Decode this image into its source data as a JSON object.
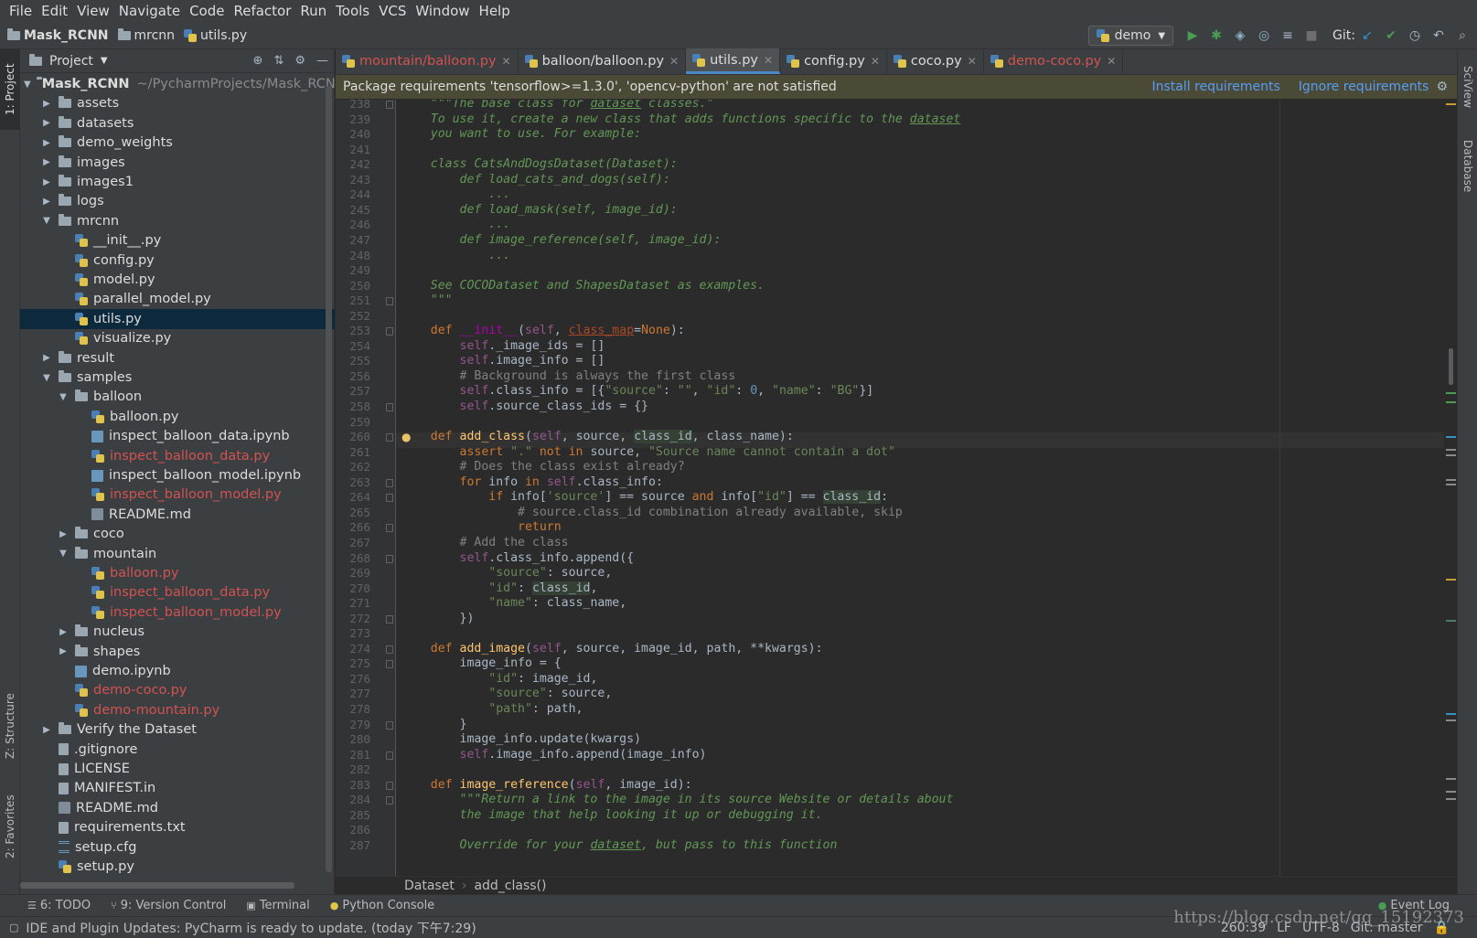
{
  "menu": [
    "File",
    "Edit",
    "View",
    "Navigate",
    "Code",
    "Refactor",
    "Run",
    "Tools",
    "VCS",
    "Window",
    "Help"
  ],
  "breadcrumb": {
    "project": "Mask_RCNN",
    "folder": "mrcnn",
    "file": "utils.py"
  },
  "run_config": "demo",
  "git_label": "Git:",
  "project_panel": {
    "title": "Project"
  },
  "tree": [
    {
      "indent": 0,
      "arrow": "down",
      "icon": "folder",
      "label": "Mask_RCNN",
      "path": "~/PycharmProjects/Mask_RCNN",
      "bold": true
    },
    {
      "indent": 1,
      "arrow": "right",
      "icon": "folder",
      "label": "assets"
    },
    {
      "indent": 1,
      "arrow": "right",
      "icon": "folder",
      "label": "datasets"
    },
    {
      "indent": 1,
      "arrow": "right",
      "icon": "folder",
      "label": "demo_weights"
    },
    {
      "indent": 1,
      "arrow": "right",
      "icon": "folder",
      "label": "images"
    },
    {
      "indent": 1,
      "arrow": "right",
      "icon": "folder",
      "label": "images1"
    },
    {
      "indent": 1,
      "arrow": "right",
      "icon": "folder",
      "label": "logs"
    },
    {
      "indent": 1,
      "arrow": "down",
      "icon": "folder",
      "label": "mrcnn"
    },
    {
      "indent": 2,
      "icon": "py",
      "label": "__init__.py"
    },
    {
      "indent": 2,
      "icon": "py",
      "label": "config.py"
    },
    {
      "indent": 2,
      "icon": "py",
      "label": "model.py"
    },
    {
      "indent": 2,
      "icon": "py",
      "label": "parallel_model.py"
    },
    {
      "indent": 2,
      "icon": "py",
      "label": "utils.py",
      "selected": true
    },
    {
      "indent": 2,
      "icon": "py",
      "label": "visualize.py"
    },
    {
      "indent": 1,
      "arrow": "right",
      "icon": "folder",
      "label": "result"
    },
    {
      "indent": 1,
      "arrow": "down",
      "icon": "folder",
      "label": "samples"
    },
    {
      "indent": 2,
      "arrow": "down",
      "icon": "folder",
      "label": "balloon"
    },
    {
      "indent": 3,
      "icon": "py",
      "label": "balloon.py"
    },
    {
      "indent": 3,
      "icon": "nb",
      "label": "inspect_balloon_data.ipynb"
    },
    {
      "indent": 3,
      "icon": "py",
      "label": "inspect_balloon_data.py",
      "red": true
    },
    {
      "indent": 3,
      "icon": "nb",
      "label": "inspect_balloon_model.ipynb"
    },
    {
      "indent": 3,
      "icon": "py",
      "label": "inspect_balloon_model.py",
      "red": true
    },
    {
      "indent": 3,
      "icon": "md",
      "label": "README.md"
    },
    {
      "indent": 2,
      "arrow": "right",
      "icon": "folder",
      "label": "coco"
    },
    {
      "indent": 2,
      "arrow": "down",
      "icon": "folder",
      "label": "mountain"
    },
    {
      "indent": 3,
      "icon": "py",
      "label": "balloon.py",
      "red": true
    },
    {
      "indent": 3,
      "icon": "py",
      "label": "inspect_balloon_data.py",
      "red": true
    },
    {
      "indent": 3,
      "icon": "py",
      "label": "inspect_balloon_model.py",
      "red": true
    },
    {
      "indent": 2,
      "arrow": "right",
      "icon": "folder",
      "label": "nucleus"
    },
    {
      "indent": 2,
      "arrow": "right",
      "icon": "folder",
      "label": "shapes"
    },
    {
      "indent": 2,
      "icon": "nb",
      "label": "demo.ipynb"
    },
    {
      "indent": 2,
      "icon": "py",
      "label": "demo-coco.py",
      "red": true
    },
    {
      "indent": 2,
      "icon": "py",
      "label": "demo-mountain.py",
      "red": true
    },
    {
      "indent": 1,
      "arrow": "right",
      "icon": "folder",
      "label": "Verify the Dataset"
    },
    {
      "indent": 1,
      "icon": "file",
      "label": ".gitignore"
    },
    {
      "indent": 1,
      "icon": "file",
      "label": "LICENSE"
    },
    {
      "indent": 1,
      "icon": "file",
      "label": "MANIFEST.in"
    },
    {
      "indent": 1,
      "icon": "md",
      "label": "README.md"
    },
    {
      "indent": 1,
      "icon": "file",
      "label": "requirements.txt"
    },
    {
      "indent": 1,
      "icon": "txt",
      "label": "setup.cfg"
    },
    {
      "indent": 1,
      "icon": "py",
      "label": "setup.py"
    }
  ],
  "tabs": [
    {
      "label": "mountain/balloon.py",
      "red": true
    },
    {
      "label": "balloon/balloon.py"
    },
    {
      "label": "utils.py",
      "active": true
    },
    {
      "label": "config.py"
    },
    {
      "label": "coco.py"
    },
    {
      "label": "demo-coco.py",
      "red": true
    }
  ],
  "banner": {
    "message": "Package requirements 'tensorflow>=1.3.0', 'opencv-python' are not satisfied",
    "install": "Install requirements",
    "ignore": "Ignore requirements"
  },
  "code": {
    "first_line": 238,
    "current_line": 260,
    "lines": [
      [
        [
          "d",
          "    \"\"\"The base class for "
        ],
        [
          "du",
          "dataset"
        ],
        [
          "d",
          " classes.\""
        ]
      ],
      [
        [
          "d",
          "    To use it, create a new class that adds functions specific to the "
        ],
        [
          "du",
          "dataset"
        ]
      ],
      [
        [
          "d",
          "    you want to use. For example:"
        ]
      ],
      [],
      [
        [
          "d",
          "    class CatsAndDogsDataset(Dataset):"
        ]
      ],
      [
        [
          "d",
          "        def load_cats_and_dogs(self):"
        ]
      ],
      [
        [
          "d",
          "            ..."
        ]
      ],
      [
        [
          "d",
          "        def load_mask(self, image_id):"
        ]
      ],
      [
        [
          "d",
          "            ..."
        ]
      ],
      [
        [
          "d",
          "        def image_reference(self, image_id):"
        ]
      ],
      [
        [
          "d",
          "            ..."
        ]
      ],
      [],
      [
        [
          "d",
          "    See COCODataset and ShapesDataset as examples."
        ]
      ],
      [
        [
          "d",
          "    \"\"\""
        ]
      ],
      [],
      [
        [
          "k",
          "    def "
        ],
        [
          "mg",
          "__init__"
        ],
        [
          "p",
          "("
        ],
        [
          "sf",
          "self"
        ],
        [
          "p",
          ", "
        ],
        [
          "pu",
          "class_map"
        ],
        [
          "p",
          "="
        ],
        [
          "k",
          "None"
        ],
        [
          "p",
          "):"
        ]
      ],
      [
        [
          "sf",
          "        self"
        ],
        [
          "p",
          "._image_ids = []"
        ]
      ],
      [
        [
          "sf",
          "        self"
        ],
        [
          "p",
          ".image_info = []"
        ]
      ],
      [
        [
          "c",
          "        # Background is always the first class"
        ]
      ],
      [
        [
          "sf",
          "        self"
        ],
        [
          "p",
          ".class_info = [{"
        ],
        [
          "s",
          "\"source\""
        ],
        [
          "p",
          ": "
        ],
        [
          "s",
          "\"\""
        ],
        [
          "p",
          ", "
        ],
        [
          "s",
          "\"id\""
        ],
        [
          "p",
          ": "
        ],
        [
          "n",
          "0"
        ],
        [
          "p",
          ", "
        ],
        [
          "s",
          "\"name\""
        ],
        [
          "p",
          ": "
        ],
        [
          "s",
          "\"BG\""
        ],
        [
          "p",
          "}]"
        ]
      ],
      [
        [
          "sf",
          "        self"
        ],
        [
          "p",
          ".source_class_ids = {}"
        ]
      ],
      [],
      [
        [
          "k",
          "    def "
        ],
        [
          "f",
          "add_class"
        ],
        [
          "p",
          "("
        ],
        [
          "sf",
          "self"
        ],
        [
          "p",
          ", source, "
        ],
        [
          "hl",
          "class_id"
        ],
        [
          "p",
          ", class_name):"
        ]
      ],
      [
        [
          "k",
          "        assert "
        ],
        [
          "s",
          "\".\""
        ],
        [
          "k",
          " not in "
        ],
        [
          "p",
          "source, "
        ],
        [
          "s",
          "\"Source name cannot contain a dot\""
        ]
      ],
      [
        [
          "c",
          "        # Does the class exist already?"
        ]
      ],
      [
        [
          "k",
          "        for "
        ],
        [
          "p",
          "info "
        ],
        [
          "k",
          "in "
        ],
        [
          "sf",
          "self"
        ],
        [
          "p",
          ".class_info:"
        ]
      ],
      [
        [
          "k",
          "            if "
        ],
        [
          "p",
          "info["
        ],
        [
          "s",
          "'source'"
        ],
        [
          "p",
          "] == source "
        ],
        [
          "k",
          "and "
        ],
        [
          "p",
          "info["
        ],
        [
          "s",
          "\"id\""
        ],
        [
          "p",
          "] == "
        ],
        [
          "hl",
          "class_id"
        ],
        [
          "p",
          ":"
        ]
      ],
      [
        [
          "c",
          "                # source.class_id combination already available, skip"
        ]
      ],
      [
        [
          "k",
          "                return"
        ]
      ],
      [
        [
          "c",
          "        # Add the class"
        ]
      ],
      [
        [
          "sf",
          "        self"
        ],
        [
          "p",
          ".class_info.append({"
        ]
      ],
      [
        [
          "s",
          "            \"source\""
        ],
        [
          "p",
          ": source,"
        ]
      ],
      [
        [
          "s",
          "            \"id\""
        ],
        [
          "p",
          ": "
        ],
        [
          "hl",
          "class_id"
        ],
        [
          "p",
          ","
        ]
      ],
      [
        [
          "s",
          "            \"name\""
        ],
        [
          "p",
          ": class_name,"
        ]
      ],
      [
        [
          "p",
          "        })"
        ]
      ],
      [],
      [
        [
          "k",
          "    def "
        ],
        [
          "f",
          "add_image"
        ],
        [
          "p",
          "("
        ],
        [
          "sf",
          "self"
        ],
        [
          "p",
          ", source, image_id, path, **kwargs):"
        ]
      ],
      [
        [
          "p",
          "        image_info = {"
        ]
      ],
      [
        [
          "s",
          "            \"id\""
        ],
        [
          "p",
          ": image_id,"
        ]
      ],
      [
        [
          "s",
          "            \"source\""
        ],
        [
          "p",
          ": source,"
        ]
      ],
      [
        [
          "s",
          "            \"path\""
        ],
        [
          "p",
          ": path,"
        ]
      ],
      [
        [
          "p",
          "        }"
        ]
      ],
      [
        [
          "p",
          "        image_info.update(kwargs)"
        ]
      ],
      [
        [
          "sf",
          "        self"
        ],
        [
          "p",
          ".image_info.append(image_info)"
        ]
      ],
      [],
      [
        [
          "k",
          "    def "
        ],
        [
          "f",
          "image_reference"
        ],
        [
          "p",
          "("
        ],
        [
          "sf",
          "self"
        ],
        [
          "p",
          ", image_id):"
        ]
      ],
      [
        [
          "d",
          "        \"\"\"Return a link to the image in its source Website or details about"
        ]
      ],
      [
        [
          "d",
          "        the image that help looking it up or debugging it."
        ]
      ],
      [],
      [
        [
          "d",
          "        Override for your "
        ],
        [
          "du",
          "dataset"
        ],
        [
          "d",
          ", but pass to this function"
        ]
      ]
    ]
  },
  "editor_breadcrumb": [
    "Dataset",
    "add_class()"
  ],
  "tool_windows": [
    "6: TODO",
    "9: Version Control",
    "Terminal",
    "Python Console"
  ],
  "event_log": "Event Log",
  "status": {
    "message": "IDE and Plugin Updates: PyCharm is ready to update. (today 下午7:29)",
    "position": "260:39",
    "line_sep": "LF",
    "encoding": "UTF-8",
    "git": "Git: master"
  },
  "left_tabs": [
    "1: Project",
    "Z: Structure",
    "2: Favorites"
  ],
  "right_tabs": [
    "SciView",
    "Database"
  ],
  "watermark": "https://blog.csdn.net/qq_15192373"
}
